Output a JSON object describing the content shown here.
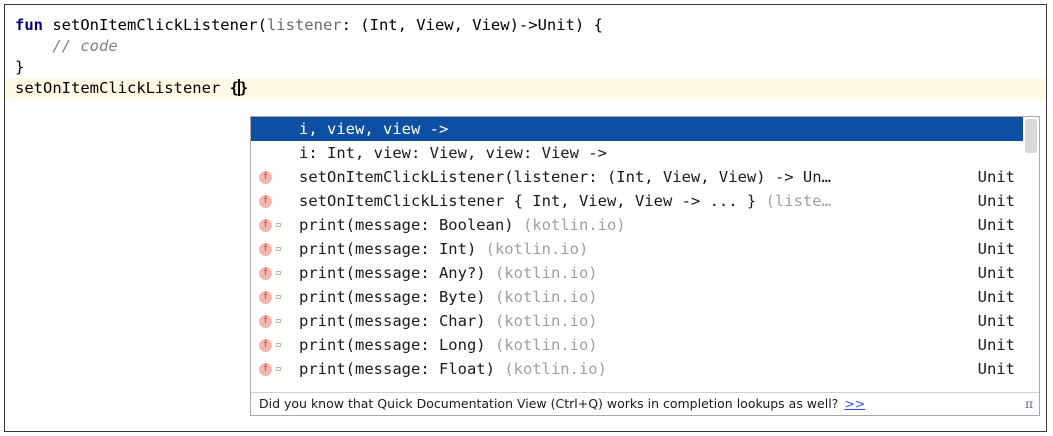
{
  "editor": {
    "line1": {
      "keyword": "fun",
      "name": " setOnItemClickListener(",
      "param": "listener",
      "rest": ": (Int, View, View)->Unit) {"
    },
    "line2": {
      "comment": "    // code"
    },
    "line3": {
      "text": "}"
    },
    "line4": {
      "prefix": "setOnItemClickListener ",
      "open_brace": "{",
      "close_brace": "}"
    }
  },
  "completion": {
    "items": [
      {
        "main": "i, view, view ->",
        "tail": "",
        "type": "",
        "icon": "",
        "selected": true
      },
      {
        "main": "i: Int, view: View, view: View ->",
        "tail": "",
        "type": "",
        "icon": ""
      },
      {
        "main": "setOnItemClickListener(listener: (Int, View, View) -> Un…",
        "tail": "",
        "type": "Unit",
        "icon": "function-icon"
      },
      {
        "main": "setOnItemClickListener { Int, View, View -> ... } ",
        "tail": "(liste…",
        "type": "Unit",
        "icon": "function-icon"
      },
      {
        "main": "print(message: Boolean) ",
        "tail": "(kotlin.io)",
        "type": "Unit",
        "icon": "function-icon",
        "lock": true
      },
      {
        "main": "print(message: Int) ",
        "tail": "(kotlin.io)",
        "type": "Unit",
        "icon": "function-icon",
        "lock": true
      },
      {
        "main": "print(message: Any?) ",
        "tail": "(kotlin.io)",
        "type": "Unit",
        "icon": "function-icon",
        "lock": true
      },
      {
        "main": "print(message: Byte) ",
        "tail": "(kotlin.io)",
        "type": "Unit",
        "icon": "function-icon",
        "lock": true
      },
      {
        "main": "print(message: Char) ",
        "tail": "(kotlin.io)",
        "type": "Unit",
        "icon": "function-icon",
        "lock": true
      },
      {
        "main": "print(message: Long) ",
        "tail": "(kotlin.io)",
        "type": "Unit",
        "icon": "function-icon",
        "lock": true
      },
      {
        "main": "print(message: Float) ",
        "tail": "(kotlin.io)",
        "type": "Unit",
        "icon": "function-icon",
        "lock": true
      }
    ],
    "icon_glyph": "f",
    "lock_glyph": "▫",
    "footer": {
      "tip": "Did you know that Quick Documentation View (Ctrl+Q) works in completion lookups as well?",
      "more": ">>",
      "pi": "π"
    },
    "colors": {
      "selected_bg": "#0d4fa3",
      "keyword": "#000080",
      "hint": "#a0a0a0"
    }
  }
}
